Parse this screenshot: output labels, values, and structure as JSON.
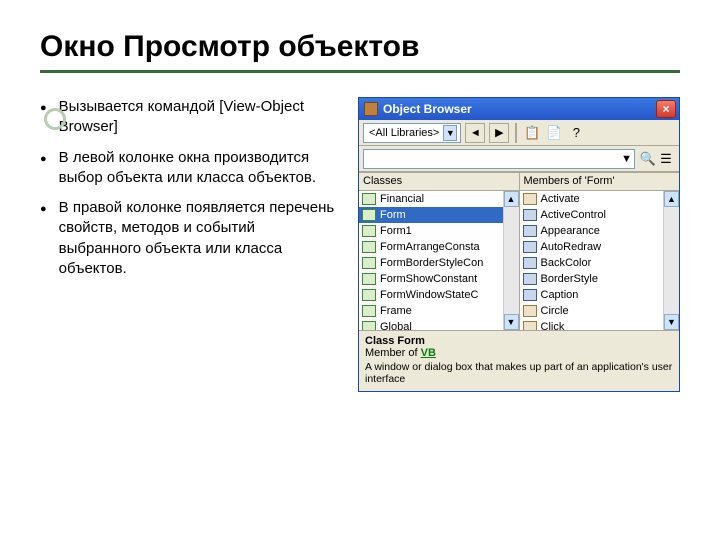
{
  "slide": {
    "title": "Окно Просмотр объектов",
    "bullets": [
      "Вызывается командой [View-Object Browser]",
      "В левой колонке окна производится выбор объекта или класса объектов.",
      "В правой колонке появляется перечень свойств, методов и событий выбранного объекта или класса объектов."
    ]
  },
  "window": {
    "title": "Object Browser",
    "library_combo": "<All Libraries>",
    "nav_back": "◄",
    "nav_fwd": "▶",
    "copy_icon": "📋",
    "help_icon": "?",
    "search_arrow": "▼",
    "binoculars": "🔍",
    "left": {
      "header": "Classes",
      "items": [
        "Financial",
        "Form",
        "Form1",
        "FormArrangeConsta",
        "FormBorderStyleCon",
        "FormShowConstant",
        "FormWindowStateC",
        "Frame",
        "Global"
      ],
      "selected_index": 1
    },
    "right": {
      "header": "Members of 'Form'",
      "items": [
        "Activate",
        "ActiveControl",
        "Appearance",
        "AutoRedraw",
        "BackColor",
        "BorderStyle",
        "Caption",
        "Circle",
        "Click"
      ]
    },
    "desc": {
      "class_label": "Class Form",
      "member_prefix": "Member of ",
      "member_link": "VB",
      "body": "A window or dialog box that makes up part of an application's user interface"
    }
  }
}
